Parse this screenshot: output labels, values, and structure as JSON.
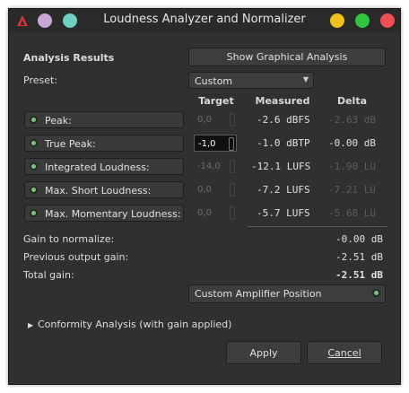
{
  "window": {
    "title": "Loudness Analyzer and Normalizer",
    "colors": {
      "dot_lilac": "#c8a7d6",
      "dot_teal": "#6fcfc2",
      "dot_yellow": "#f3c21a",
      "dot_green": "#2ec63f",
      "dot_red": "#ef4f53",
      "logo": "#e0303a"
    }
  },
  "analysis": {
    "heading": "Analysis Results",
    "show_graph_label": "Show Graphical Analysis",
    "preset_label": "Preset:",
    "preset_value": "Custom"
  },
  "columns": {
    "target": "Target",
    "measured": "Measured",
    "delta": "Delta"
  },
  "rows": [
    {
      "label": "Peak:",
      "target": "0,0",
      "measured": "-2.6 dBFS",
      "delta": "-2.63 dB"
    },
    {
      "label": "True Peak:",
      "target": "-1,0",
      "measured": "-1.0 dBTP",
      "delta": "-0.00 dB"
    },
    {
      "label": "Integrated Loudness:",
      "target": "-14,0",
      "measured": "-12.1 LUFS",
      "delta": "-1.90 LU"
    },
    {
      "label": "Max. Short Loudness:",
      "target": "0,0",
      "measured": "-7.2 LUFS",
      "delta": "-7.21 LU"
    },
    {
      "label": "Max. Momentary Loudness:",
      "target": "0,0",
      "measured": "-5.7 LUFS",
      "delta": "-5.68 LU"
    }
  ],
  "gain": {
    "normalize_label": "Gain to normalize:",
    "normalize_value": "-0.00 dB",
    "previous_label": "Previous output gain:",
    "previous_value": "-2.51 dB",
    "total_label": "Total gain:",
    "total_value": "-2.51 dB"
  },
  "custom_amp_label": "Custom Amplifier Position",
  "conformity_label": "Conformity Analysis (with gain applied)",
  "apply_label": "Apply",
  "cancel_label": "Cancel"
}
